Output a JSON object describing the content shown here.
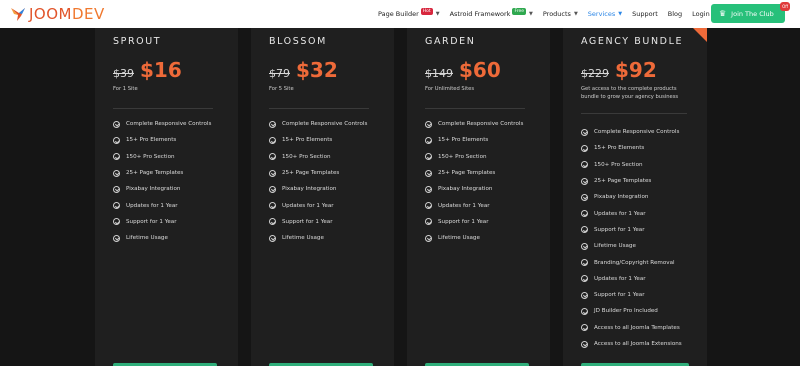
{
  "brand": {
    "name_prefix": "JOOM",
    "name_suffix": "DEV"
  },
  "nav": {
    "items": [
      {
        "label": "Page Builder",
        "badge": "Hot",
        "dropdown": true
      },
      {
        "label": "Astroid Framework",
        "badge": "Free",
        "dropdown": true
      },
      {
        "label": "Products",
        "dropdown": true
      },
      {
        "label": "Services",
        "dropdown": true,
        "active": true
      },
      {
        "label": "Support"
      },
      {
        "label": "Blog"
      },
      {
        "label": "Login"
      }
    ],
    "join_label": "Join The Club",
    "join_badge": "Off"
  },
  "plans": [
    {
      "name": "SPROUT",
      "old_price": "$39",
      "new_price": "$16",
      "desc": "For 1 Site",
      "features": [
        "Complete Responsive Controls",
        "15+ Pro Elements",
        "150+ Pro Section",
        "25+ Page Templates",
        "Pixabay Integration",
        "Updates for 1 Year",
        "Support for 1 Year",
        "Lifetime Usage"
      ]
    },
    {
      "name": "BLOSSOM",
      "old_price": "$79",
      "new_price": "$32",
      "desc": "For 5 Site",
      "features": [
        "Complete Responsive Controls",
        "15+ Pro Elements",
        "150+ Pro Section",
        "25+ Page Templates",
        "Pixabay Integration",
        "Updates for 1 Year",
        "Support for 1 Year",
        "Lifetime Usage"
      ]
    },
    {
      "name": "GARDEN",
      "old_price": "$149",
      "new_price": "$60",
      "desc": "For Unlimited Sites",
      "features": [
        "Complete Responsive Controls",
        "15+ Pro Elements",
        "150+ Pro Section",
        "25+ Page Templates",
        "Pixabay Integration",
        "Updates for 1 Year",
        "Support for 1 Year",
        "Lifetime Usage"
      ]
    },
    {
      "name": "AGENCY BUNDLE",
      "old_price": "$229",
      "new_price": "$92",
      "desc_line1": "Get access to the complete products",
      "desc_line2": "bundle to grow your agency business",
      "features": [
        "Complete Responsive Controls",
        "15+ Pro Elements",
        "150+ Pro Section",
        "25+ Page Templates",
        "Pixabay Integration",
        "Updates for 1 Year",
        "Support for 1 Year",
        "Lifetime Usage",
        "Branding/Copyright Removal",
        "Updates for 1 Year",
        "Support for 1 Year",
        "JD Builder Pro Included",
        "Access to all Joomla Templates",
        "Access to all Joomla Extensions"
      ]
    }
  ],
  "colors": {
    "accent": "#ee6a39",
    "join_green": "#27c07a",
    "active_nav": "#2b86e6",
    "card_bg": "#1f1f1f",
    "page_bg": "#151515"
  }
}
